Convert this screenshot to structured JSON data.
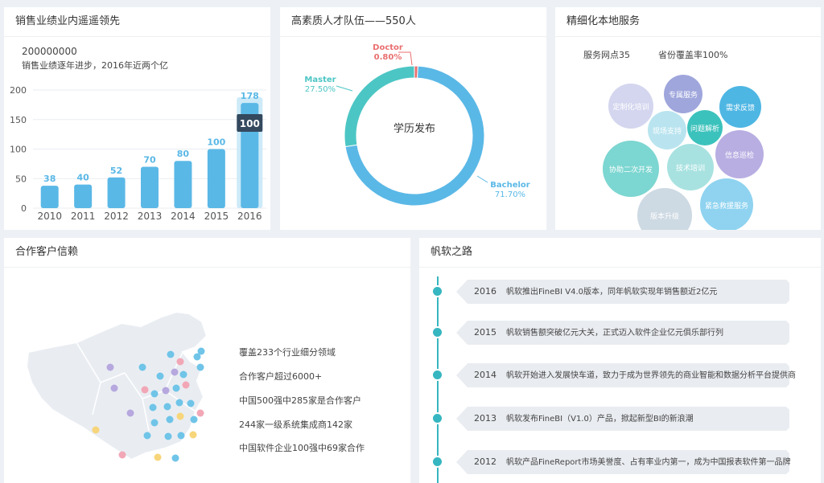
{
  "panel_sales": {
    "title": "销售业绩业内遥遥领先",
    "big_number": "200000000",
    "subtitle": "销售业绩逐年进步，2016年近两个亿",
    "highlight_label": "100"
  },
  "panel_talent": {
    "title": "高素质人才队伍——550人",
    "center_label": "学历发布",
    "labels": {
      "doctor_name": "Doctor",
      "doctor_pct": "0.80%",
      "master_name": "Master",
      "master_pct": "27.50%",
      "bachelor_name": "Bachelor",
      "bachelor_pct": "71.70%"
    }
  },
  "panel_service": {
    "title": "精细化本地服务",
    "stat_outlets": "服务网点35",
    "stat_coverage": "省份覆盖率100%",
    "bubbles": [
      "定制化培训",
      "专属服务",
      "需求反馈",
      "现场支持",
      "问题解析",
      "信息巡检",
      "协助二次开发",
      "技术培训",
      "紧急救援服务",
      "版本升级"
    ]
  },
  "panel_clients": {
    "title": "合作客户信赖",
    "lines": [
      "覆盖233个行业细分领域",
      "合作客户超过6000+",
      "中国500强中285家是合作客户",
      "244家一级系统集成商142家",
      "中国软件企业100强中69家合作"
    ]
  },
  "panel_history": {
    "title": "帆软之路",
    "milestones": [
      {
        "year": "2016",
        "text": "帆软推出FineBI V4.0版本，同年帆软实现年销售额近2亿元"
      },
      {
        "year": "2015",
        "text": "帆软销售额突破亿元大关，正式迈入软件企业亿元俱乐部行列"
      },
      {
        "year": "2014",
        "text": "帆软开始进入发展快车道，致力于成为世界领先的商业智能和数据分析平台提供商"
      },
      {
        "year": "2013",
        "text": "帆软发布FineBI（V1.0）产品，掀起新型BI的新浪潮"
      },
      {
        "year": "2012",
        "text": "帆软产品FineReport市场美誉度、占有率业内第一，成为中国报表软件第一品牌"
      }
    ]
  },
  "colors": {
    "bar": "#5ab8e6",
    "bar_highlight_bg": "#cdeaf8",
    "bachelor": "#5ab8e6",
    "master": "#4cc6c4",
    "doctor": "#e96f6f",
    "timeline": "#36b6c0"
  },
  "chart_data": [
    {
      "type": "bar",
      "categories": [
        "2010",
        "2011",
        "2012",
        "2013",
        "2014",
        "2015",
        "2016"
      ],
      "values": [
        38,
        40,
        52,
        70,
        80,
        100,
        178
      ],
      "ylim": [
        0,
        200
      ],
      "yticks": [
        "0",
        "50",
        "100",
        "150",
        "200"
      ],
      "title": "",
      "xlabel": "",
      "ylabel": "",
      "grid": true
    },
    {
      "type": "pie",
      "labels": [
        "Bachelor",
        "Master",
        "Doctor"
      ],
      "values": [
        71.7,
        27.5,
        0.8
      ],
      "title": ""
    }
  ]
}
